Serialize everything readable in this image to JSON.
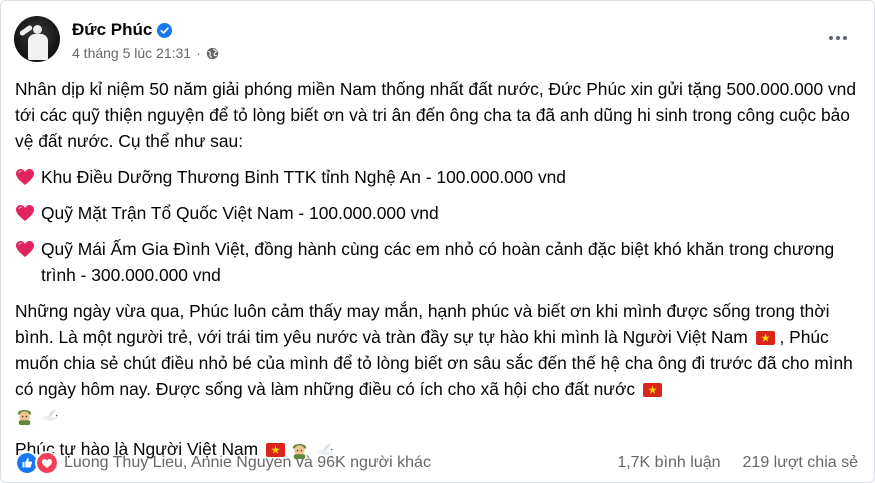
{
  "post": {
    "author": "Đức Phúc",
    "timestamp": "4 tháng 5 lúc 21:31",
    "meta_separator": "·",
    "verified_icon": "verified-badge-icon",
    "audience_icon": "globe-icon",
    "more_icon": "more-options-icon",
    "intro": "Nhân dịp kỉ niệm 50 năm giải phóng miền Nam thống nhất đất nước, Đức Phúc xin gửi tặng 500.000.000 vnd tới các quỹ thiện nguyện để tỏ lòng biết ơn và tri ân đến ông cha ta đã anh dũng hi sinh trong công cuộc bảo vệ đất nước. Cụ thể như sau:",
    "donations": [
      "Khu Điều Dưỡng Thương Binh TTK tỉnh Nghệ An - 100.000.000 vnd",
      "Quỹ Mặt Trận Tổ Quốc Việt Nam - 100.000.000 vnd",
      "Quỹ Mái Ấm Gia Đình Việt, đồng hành cùng các em nhỏ có hoàn cảnh đặc biệt khó khăn trong chương trình - 300.000.000 vnd"
    ],
    "para2_a": "Những ngày vừa qua, Phúc luôn cảm thấy may mắn, hạnh phúc và biết ơn khi mình được sống trong thời bình. Là một người trẻ, với trái tim yêu nước và tràn đầy sự tự hào khi mình là Người Việt Nam",
    "para2_b": ", Phúc muốn chia sẻ chút điều nhỏ bé của mình để tỏ lòng biết ơn sâu sắc đến thế hệ cha ông đi trước đã cho mình có ngày hôm nay. Được sống và làm những điều có ích cho xã hội cho đất nước",
    "closing": "Phúc tự hào là Người Việt Nam"
  },
  "footer": {
    "reactors": "Luong Thuy Lieu, Annie Nguyen và 96K người khác",
    "comments": "1,7K bình luận",
    "shares": "219 lượt chia sẻ"
  },
  "colors": {
    "like_blue": "#1877f2",
    "love_red": "#f33e58",
    "text_secondary": "#65676b"
  }
}
